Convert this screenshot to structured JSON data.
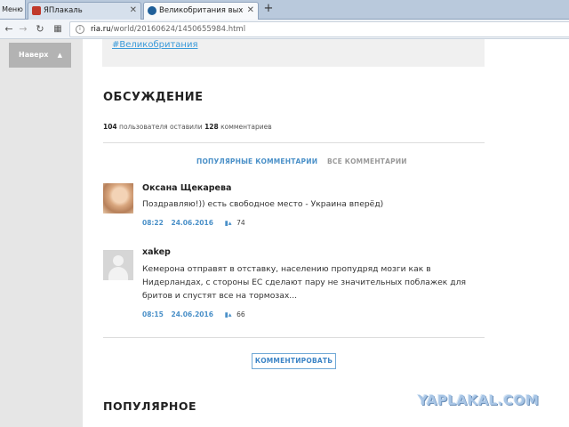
{
  "browser": {
    "menu_label": "Меню",
    "tabs": [
      {
        "title": "ЯПлакаль",
        "active": false,
        "favicon_color": "#c0392b"
      },
      {
        "title": "Великобритания выходит",
        "active": true,
        "favicon_color": "#1f5f99"
      }
    ],
    "new_tab_icon": "plus-icon",
    "url_host": "ria.ru",
    "url_path": "/world/20160624/1450655984.html"
  },
  "page": {
    "back_to_top_label": "Наверх",
    "tag_link": "#Великобритания",
    "discussion_heading": "ОБСУЖДЕНИЕ",
    "stats": {
      "users_count": "104",
      "users_text": "пользователя оставили",
      "comments_count": "128",
      "comments_text": "комментариев"
    },
    "comment_tabs": {
      "popular": "ПОПУЛЯРНЫЕ КОММЕНТАРИИ",
      "all": "ВСЕ КОММЕНТАРИИ"
    },
    "comments": [
      {
        "author": "Оксана Щекарева",
        "text": "Поздравляю!)) есть свободное место - Украина вперёд)",
        "time": "08:22",
        "date": "24.06.2016",
        "likes": "74"
      },
      {
        "author": "xakep",
        "text": "Кемерона отправят в отставку, населению пропудряд мозги как в Нидерландах, с стороны ЕС сделают пару не значительных поблажек для бритов и спустят все на тормозах...",
        "time": "08:15",
        "date": "24.06.2016",
        "likes": "66"
      }
    ],
    "comment_button": "КОММЕНТИРОВАТЬ",
    "popular_heading": "ПОПУЛЯРНОЕ"
  },
  "watermark": "YAPLAKAL.COM",
  "colors": {
    "link": "#3a9ad9",
    "accent": "#4a90c8"
  }
}
